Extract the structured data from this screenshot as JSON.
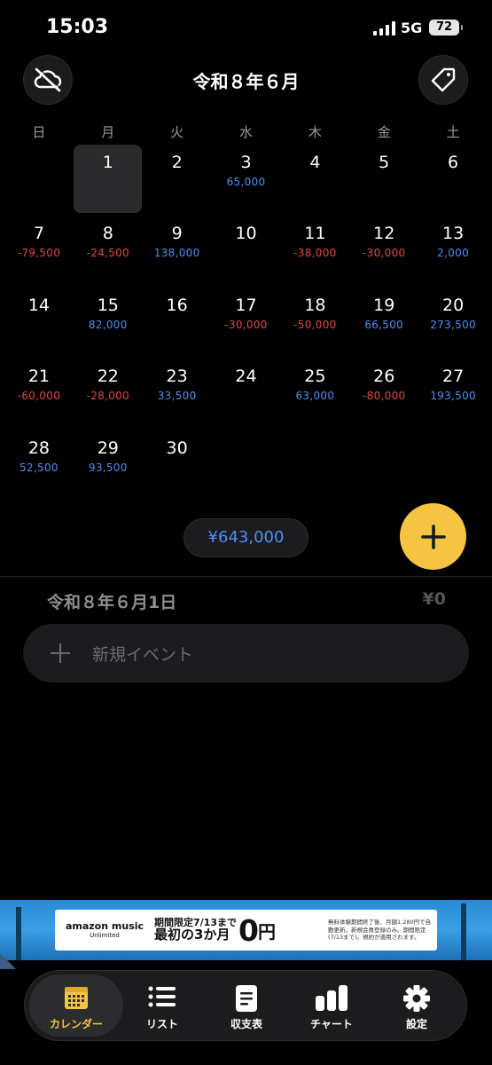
{
  "status_bar": {
    "time": "15:03",
    "network": "5G",
    "battery": "72"
  },
  "header": {
    "title": "令和８年６月",
    "left_icon": "cloud-off-icon",
    "right_icon": "tag-icon"
  },
  "weekdays": [
    "日",
    "月",
    "火",
    "水",
    "木",
    "金",
    "土"
  ],
  "calendar": {
    "first_weekday_offset": 1,
    "selected_day": "1",
    "days": [
      {
        "day": "1",
        "amount": "",
        "sign": ""
      },
      {
        "day": "2",
        "amount": "",
        "sign": ""
      },
      {
        "day": "3",
        "amount": "65,000",
        "sign": "pos"
      },
      {
        "day": "4",
        "amount": "",
        "sign": ""
      },
      {
        "day": "5",
        "amount": "",
        "sign": ""
      },
      {
        "day": "6",
        "amount": "",
        "sign": ""
      },
      {
        "day": "7",
        "amount": "-79,500",
        "sign": "neg"
      },
      {
        "day": "8",
        "amount": "-24,500",
        "sign": "neg"
      },
      {
        "day": "9",
        "amount": "138,000",
        "sign": "pos"
      },
      {
        "day": "10",
        "amount": "",
        "sign": ""
      },
      {
        "day": "11",
        "amount": "-38,000",
        "sign": "neg"
      },
      {
        "day": "12",
        "amount": "-30,000",
        "sign": "neg"
      },
      {
        "day": "13",
        "amount": "2,000",
        "sign": "pos"
      },
      {
        "day": "14",
        "amount": "",
        "sign": ""
      },
      {
        "day": "15",
        "amount": "82,000",
        "sign": "pos"
      },
      {
        "day": "16",
        "amount": "",
        "sign": ""
      },
      {
        "day": "17",
        "amount": "-30,000",
        "sign": "neg"
      },
      {
        "day": "18",
        "amount": "-50,000",
        "sign": "neg"
      },
      {
        "day": "19",
        "amount": "66,500",
        "sign": "pos"
      },
      {
        "day": "20",
        "amount": "273,500",
        "sign": "pos"
      },
      {
        "day": "21",
        "amount": "-60,000",
        "sign": "neg"
      },
      {
        "day": "22",
        "amount": "-28,000",
        "sign": "neg"
      },
      {
        "day": "23",
        "amount": "33,500",
        "sign": "pos"
      },
      {
        "day": "24",
        "amount": "",
        "sign": ""
      },
      {
        "day": "25",
        "amount": "63,000",
        "sign": "pos"
      },
      {
        "day": "26",
        "amount": "-80,000",
        "sign": "neg"
      },
      {
        "day": "27",
        "amount": "193,500",
        "sign": "pos"
      },
      {
        "day": "28",
        "amount": "52,500",
        "sign": "pos"
      },
      {
        "day": "29",
        "amount": "93,500",
        "sign": "pos"
      },
      {
        "day": "30",
        "amount": "",
        "sign": ""
      }
    ]
  },
  "summary": {
    "total": "¥643,000"
  },
  "selected_date": {
    "label": "令和８年６月1日",
    "total": "¥0"
  },
  "new_event": {
    "placeholder": "新規イベント"
  },
  "ad": {
    "brand_line1": "amazon music",
    "brand_line2": "Unlimited",
    "headline1": "期間限定7/13まで",
    "headline2": "最初の3か月",
    "headline_big": "0",
    "headline_unit": "円",
    "fine_print": "無料体験期間終了後、月額1,280円で自動更新。新規会員登録のみ。期間限定(7/13まで)。規約が適用されます。"
  },
  "tabs": [
    {
      "label": "カレンダー",
      "icon": "calendar-icon",
      "active": true
    },
    {
      "label": "リスト",
      "icon": "list-icon",
      "active": false
    },
    {
      "label": "収支表",
      "icon": "document-icon",
      "active": false
    },
    {
      "label": "チャート",
      "icon": "bar-chart-icon",
      "active": false
    },
    {
      "label": "設定",
      "icon": "gear-icon",
      "active": false
    }
  ],
  "colors": {
    "positive": "#4d8ff7",
    "negative": "#e2473f",
    "accent": "#f5c542",
    "background": "#000000"
  }
}
